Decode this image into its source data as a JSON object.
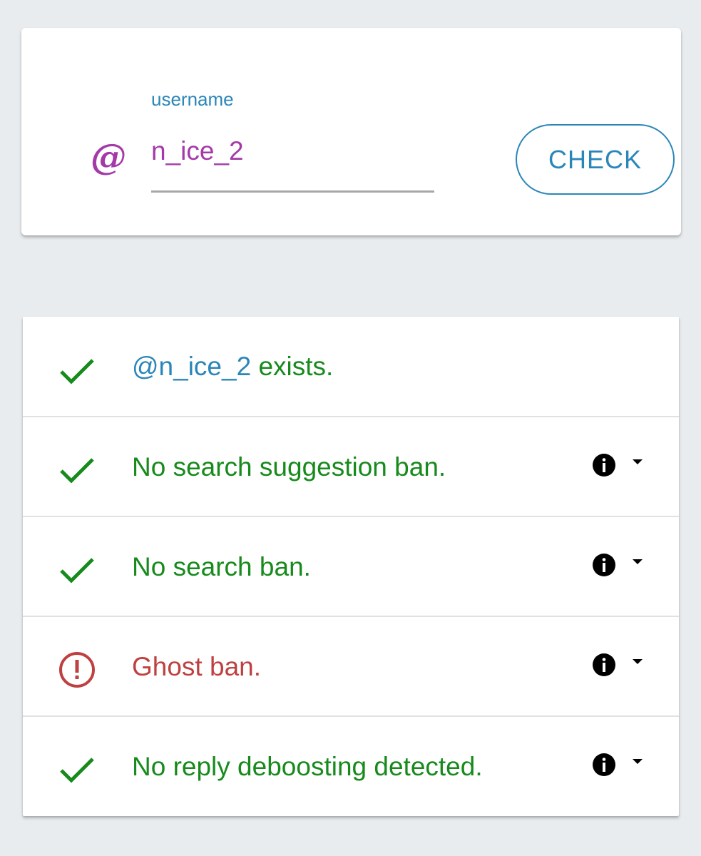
{
  "search": {
    "at_symbol": "@",
    "label": "username",
    "value": "n_ice_2",
    "button_label": "CHECK"
  },
  "results": {
    "exists": {
      "handle": "@n_ice_2",
      "text": " exists.",
      "status": "ok"
    },
    "rows": [
      {
        "text": "No search suggestion ban.",
        "status": "ok"
      },
      {
        "text": "No search ban.",
        "status": "ok"
      },
      {
        "text": "Ghost ban.",
        "status": "warning"
      },
      {
        "text": "No reply deboosting detected.",
        "status": "ok"
      }
    ]
  },
  "colors": {
    "background": "#e8ecef",
    "accent": "#2a86b9",
    "username": "#a43aa8",
    "ok": "#178a1c",
    "warning": "#bf4040"
  },
  "icons": {
    "ok": "check-icon",
    "warning": "error-circle-icon",
    "info": "info-icon",
    "expand": "caret-down-icon"
  }
}
